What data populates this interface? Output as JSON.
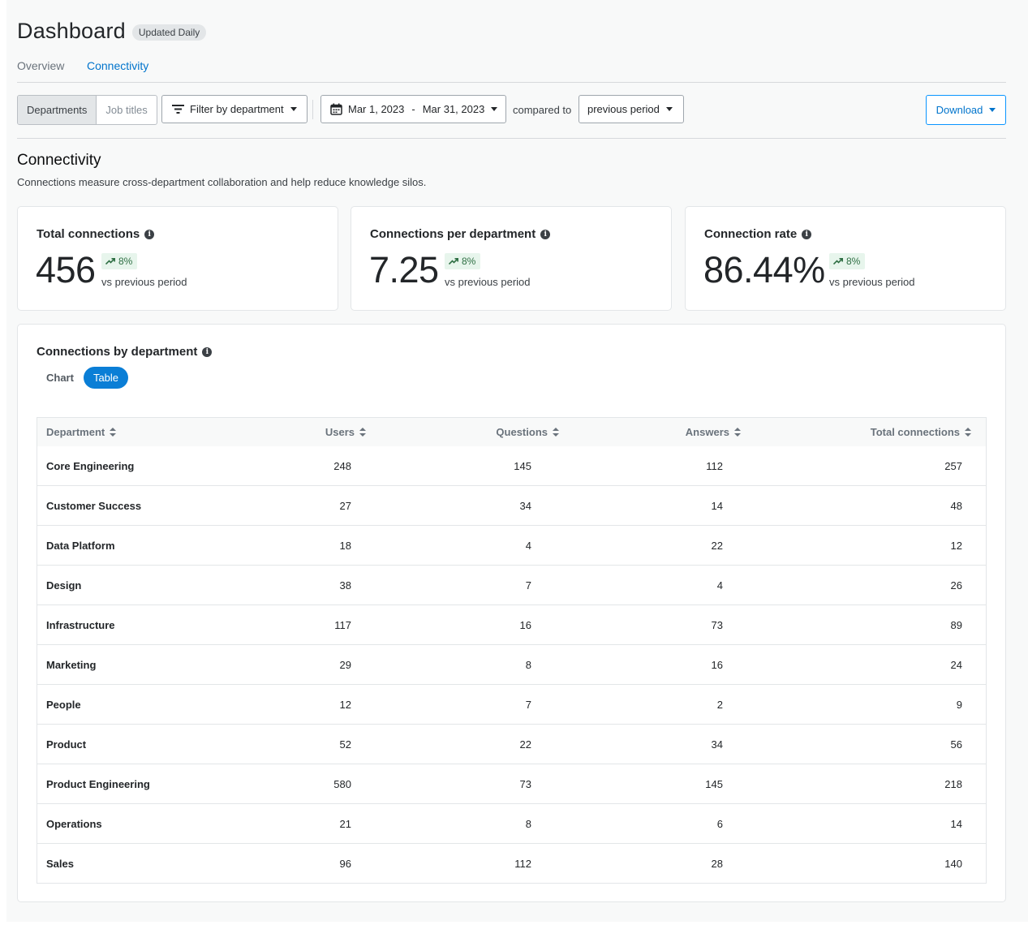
{
  "header": {
    "title": "Dashboard",
    "badge": "Updated Daily"
  },
  "tabs": [
    {
      "label": "Overview",
      "active": false
    },
    {
      "label": "Connectivity",
      "active": true
    }
  ],
  "toolbar": {
    "segment": [
      {
        "label": "Departments",
        "selected": true
      },
      {
        "label": "Job titles",
        "selected": false
      }
    ],
    "filter_label": "Filter by department",
    "date_start": "Mar 1, 2023",
    "date_sep": "-",
    "date_end": "Mar 31, 2023",
    "compared_label": "compared to",
    "compare_value": "previous period",
    "download_label": "Download"
  },
  "section": {
    "title": "Connectivity",
    "description": "Connections measure cross-department collaboration and help reduce knowledge silos."
  },
  "metrics": [
    {
      "label": "Total connections",
      "value": "456",
      "delta": "8%",
      "comparison": "vs previous period"
    },
    {
      "label": "Connections per department",
      "value": "7.25",
      "delta": "8%",
      "comparison": "vs previous period"
    },
    {
      "label": "Connection rate",
      "value": "86.44%",
      "delta": "8%",
      "comparison": "vs previous period"
    }
  ],
  "table_card": {
    "title": "Connections by department",
    "view_toggle": [
      {
        "label": "Chart",
        "selected": false
      },
      {
        "label": "Table",
        "selected": true
      }
    ],
    "columns": [
      "Department",
      "Users",
      "Questions",
      "Answers",
      "Total connections"
    ],
    "rows": [
      [
        "Core Engineering",
        "248",
        "145",
        "112",
        "257"
      ],
      [
        "Customer Success",
        "27",
        "34",
        "14",
        "48"
      ],
      [
        "Data Platform",
        "18",
        "4",
        "22",
        "12"
      ],
      [
        "Design",
        "38",
        "7",
        "4",
        "26"
      ],
      [
        "Infrastructure",
        "117",
        "16",
        "73",
        "89"
      ],
      [
        "Marketing",
        "29",
        "8",
        "16",
        "24"
      ],
      [
        "People",
        "12",
        "7",
        "2",
        "9"
      ],
      [
        "Product",
        "52",
        "22",
        "34",
        "56"
      ],
      [
        "Product Engineering",
        "580",
        "73",
        "145",
        "218"
      ],
      [
        "Operations",
        "21",
        "8",
        "6",
        "14"
      ],
      [
        "Sales",
        "96",
        "112",
        "28",
        "140"
      ]
    ]
  },
  "colors": {
    "accent": "#0074cc",
    "positive_bg": "#e7f5ec",
    "positive_text": "#2f6f44"
  }
}
